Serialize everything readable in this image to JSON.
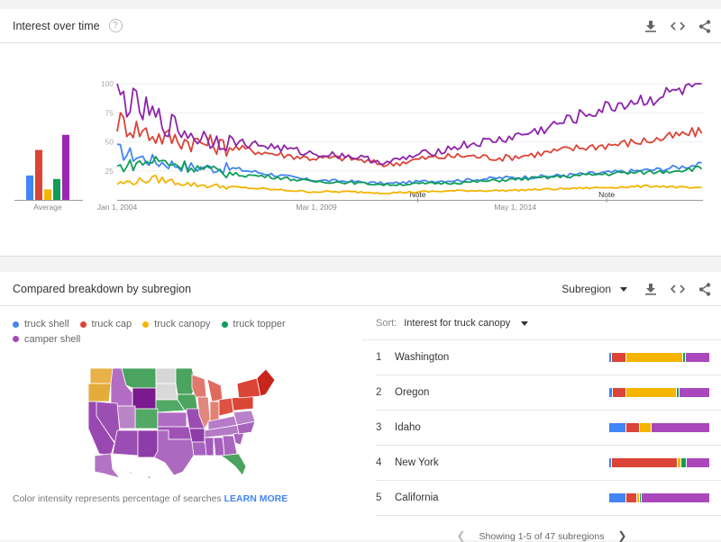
{
  "interest_over_time": {
    "title": "Interest over time",
    "help_icon": "help-circle-icon",
    "actions": [
      "download-icon",
      "embed-code-icon",
      "share-icon"
    ]
  },
  "breakdown": {
    "title": "Compared breakdown by subregion",
    "dropdown_label": "Subregion",
    "actions": [
      "download-icon",
      "embed-code-icon",
      "share-icon"
    ],
    "legend": [
      {
        "label": "truck shell",
        "color": "#4285f4"
      },
      {
        "label": "truck cap",
        "color": "#db4437"
      },
      {
        "label": "truck canopy",
        "color": "#f4b400"
      },
      {
        "label": "truck topper",
        "color": "#0f9d58"
      },
      {
        "label": "camper shell",
        "color": "#ab47bc"
      }
    ],
    "map_note": "Color intensity represents percentage of searches",
    "learn_more": "LEARN MORE",
    "sort_label": "Sort:",
    "sort_value": "Interest for truck canopy",
    "rows": [
      {
        "rank": "1",
        "name": "Washington",
        "shares": [
          3,
          14,
          56,
          3,
          24
        ]
      },
      {
        "rank": "2",
        "name": "Oregon",
        "shares": [
          4,
          13,
          50,
          3,
          30
        ]
      },
      {
        "rank": "3",
        "name": "Idaho",
        "shares": [
          17,
          13,
          12,
          0,
          58
        ]
      },
      {
        "rank": "4",
        "name": "New York",
        "shares": [
          3,
          65,
          3,
          6,
          23
        ]
      },
      {
        "rank": "5",
        "name": "California",
        "shares": [
          17,
          11,
          2,
          2,
          68
        ]
      }
    ],
    "pager_text": "Showing 1-5 of 47 subregions"
  },
  "chart_data": {
    "type": "line",
    "title": "Interest over time",
    "xlabel": "",
    "ylabel": "",
    "ylim": [
      0,
      100
    ],
    "yticks": [
      25,
      50,
      75,
      100
    ],
    "grid": true,
    "x_tick_labels": [
      "Jan 1, 2004",
      "Mar 1, 2009",
      "May 1, 2014"
    ],
    "x_range": [
      "2004-01",
      "2019-03"
    ],
    "annotations": [
      {
        "label": "Note",
        "date": "2011-01"
      },
      {
        "label": "Note",
        "date": "2016-01"
      }
    ],
    "average_bars": {
      "label": "Average",
      "values": [
        {
          "series": "truck shell",
          "value": 21
        },
        {
          "series": "truck cap",
          "value": 43
        },
        {
          "series": "truck canopy",
          "value": 9
        },
        {
          "series": "truck topper",
          "value": 18
        },
        {
          "series": "camper shell",
          "value": 56
        }
      ]
    },
    "series_keyframes_note": "yearly approximate values read from chart (monthly detail interpolated with noise)",
    "x_years": [
      2004,
      2005,
      2006,
      2007,
      2008,
      2009,
      2010,
      2011,
      2012,
      2013,
      2014,
      2015,
      2016,
      2017,
      2018,
      2019
    ],
    "series": [
      {
        "name": "truck shell",
        "color": "#4285f4",
        "values": [
          42,
          33,
          28,
          27,
          22,
          17,
          16,
          14,
          16,
          17,
          19,
          20,
          22,
          24,
          26,
          30
        ]
      },
      {
        "name": "truck cap",
        "color": "#db4437",
        "values": [
          68,
          55,
          50,
          45,
          40,
          36,
          36,
          30,
          36,
          38,
          36,
          40,
          45,
          48,
          52,
          58
        ]
      },
      {
        "name": "truck canopy",
        "color": "#f4b400",
        "values": [
          14,
          18,
          13,
          11,
          9,
          7,
          7,
          6,
          7,
          8,
          8,
          9,
          10,
          11,
          12,
          10
        ]
      },
      {
        "name": "truck topper",
        "color": "#0f9d58",
        "values": [
          28,
          34,
          28,
          22,
          20,
          16,
          15,
          13,
          14,
          15,
          17,
          19,
          21,
          23,
          24,
          27
        ]
      },
      {
        "name": "camper shell",
        "color": "#8e24aa",
        "values": [
          90,
          70,
          55,
          50,
          46,
          40,
          38,
          32,
          40,
          47,
          52,
          60,
          72,
          82,
          88,
          98
        ]
      }
    ]
  }
}
